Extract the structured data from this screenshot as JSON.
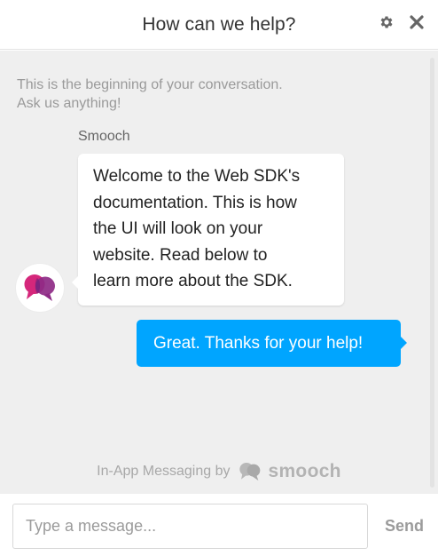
{
  "header": {
    "title": "How can we help?",
    "settings_icon": "gear-icon",
    "close_icon": "close-icon"
  },
  "conversation": {
    "intro_line1": "This is the beginning of your conversation.",
    "intro_line2": "Ask us anything!",
    "messages": [
      {
        "role": "appMaker",
        "author": "Smooch",
        "avatar_icon": "smooch-logo-icon",
        "lines": [
          "Welcome to the Web SDK's",
          "documentation. This is how",
          "the UI will look on your",
          "website. Read below to",
          "learn more about the SDK."
        ]
      },
      {
        "role": "user",
        "text": "Great. Thanks for your help!"
      }
    ],
    "branding": {
      "label": "In-App Messaging by",
      "brand": "smooch"
    }
  },
  "composer": {
    "placeholder": "Type a message...",
    "value": "",
    "send_label": "Send"
  },
  "colors": {
    "accent": "#00a5ff",
    "background": "#efefef",
    "avatar_pink": "#d5277b",
    "avatar_purple": "#7a2d8f"
  }
}
